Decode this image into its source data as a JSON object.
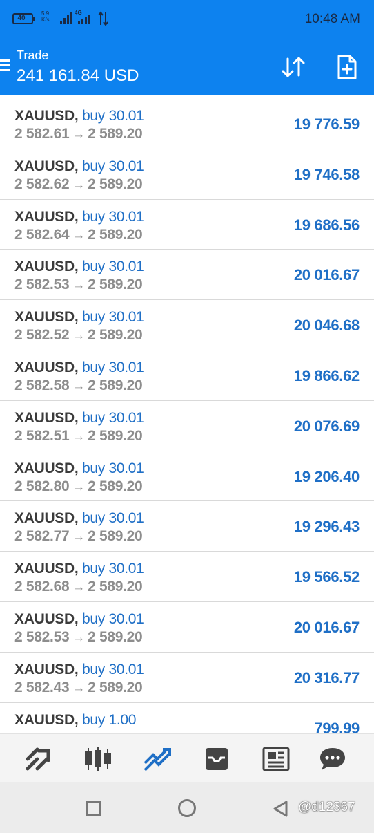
{
  "status_bar": {
    "battery": "40",
    "speed_value": "5.9",
    "speed_unit": "K/s",
    "network": "4G",
    "time": "10:48 AM"
  },
  "header": {
    "title": "Trade",
    "balance": "241 161.84 USD",
    "icons": [
      "menu-icon",
      "sort-icon",
      "new-order-icon"
    ]
  },
  "positions": [
    {
      "symbol": "XAUUSD,",
      "side": "buy 30.01",
      "open": "2 582.61",
      "current": "2 589.20",
      "profit": "19 776.59"
    },
    {
      "symbol": "XAUUSD,",
      "side": "buy 30.01",
      "open": "2 582.62",
      "current": "2 589.20",
      "profit": "19 746.58"
    },
    {
      "symbol": "XAUUSD,",
      "side": "buy 30.01",
      "open": "2 582.64",
      "current": "2 589.20",
      "profit": "19 686.56"
    },
    {
      "symbol": "XAUUSD,",
      "side": "buy 30.01",
      "open": "2 582.53",
      "current": "2 589.20",
      "profit": "20 016.67"
    },
    {
      "symbol": "XAUUSD,",
      "side": "buy 30.01",
      "open": "2 582.52",
      "current": "2 589.20",
      "profit": "20 046.68"
    },
    {
      "symbol": "XAUUSD,",
      "side": "buy 30.01",
      "open": "2 582.58",
      "current": "2 589.20",
      "profit": "19 866.62"
    },
    {
      "symbol": "XAUUSD,",
      "side": "buy 30.01",
      "open": "2 582.51",
      "current": "2 589.20",
      "profit": "20 076.69"
    },
    {
      "symbol": "XAUUSD,",
      "side": "buy 30.01",
      "open": "2 582.80",
      "current": "2 589.20",
      "profit": "19 206.40"
    },
    {
      "symbol": "XAUUSD,",
      "side": "buy 30.01",
      "open": "2 582.77",
      "current": "2 589.20",
      "profit": "19 296.43"
    },
    {
      "symbol": "XAUUSD,",
      "side": "buy 30.01",
      "open": "2 582.68",
      "current": "2 589.20",
      "profit": "19 566.52"
    },
    {
      "symbol": "XAUUSD,",
      "side": "buy 30.01",
      "open": "2 582.53",
      "current": "2 589.20",
      "profit": "20 016.67"
    },
    {
      "symbol": "XAUUSD,",
      "side": "buy 30.01",
      "open": "2 582.43",
      "current": "2 589.20",
      "profit": "20 316.77"
    },
    {
      "symbol": "XAUUSD,",
      "side": "buy 1.00",
      "open": "",
      "current": "",
      "profit": "799.99"
    }
  ],
  "arrow_glyph": "→",
  "tabs": [
    {
      "name": "quotes-tab",
      "icon": "quotes-icon"
    },
    {
      "name": "chart-tab",
      "icon": "candlestick-icon"
    },
    {
      "name": "trade-tab",
      "icon": "trade-icon",
      "active": true
    },
    {
      "name": "history-tab",
      "icon": "inbox-icon"
    },
    {
      "name": "news-tab",
      "icon": "news-icon"
    },
    {
      "name": "chat-tab",
      "icon": "chat-icon"
    }
  ],
  "watermark": "@d12367",
  "colors": {
    "header": "#0d82ef",
    "accent": "#1f6fc6",
    "text_dark": "#3b3b3b",
    "text_grey": "#8d8d8d"
  }
}
